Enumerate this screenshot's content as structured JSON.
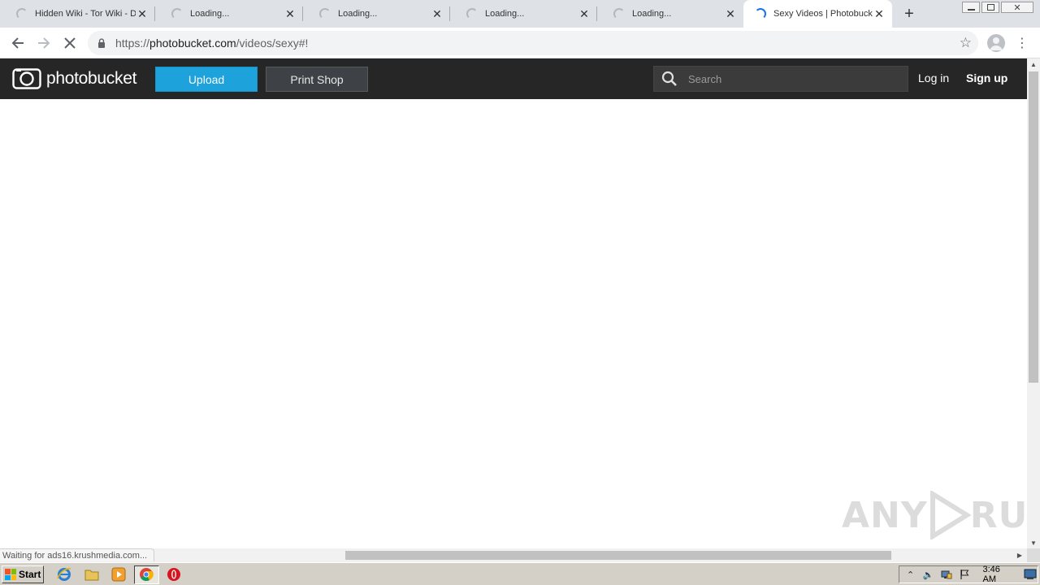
{
  "browser": {
    "tabs": [
      {
        "title": "Hidden Wiki - Tor Wiki - D",
        "active": false
      },
      {
        "title": "Loading...",
        "active": false
      },
      {
        "title": "Loading...",
        "active": false
      },
      {
        "title": "Loading...",
        "active": false
      },
      {
        "title": "Loading...",
        "active": false
      },
      {
        "title": "Sexy Videos | Photobuck",
        "active": true
      }
    ],
    "new_tab_symbol": "+",
    "url_scheme": "https://",
    "url_host": "photobucket.com",
    "url_path": "/videos/sexy#!",
    "status_text": "Waiting for ads16.krushmedia.com...",
    "icons": {
      "back": "back-arrow-icon",
      "forward": "forward-arrow-icon",
      "stop": "stop-loading-icon",
      "bookmark": "star-icon",
      "profile": "profile-avatar-icon",
      "menu": "kebab-menu-icon"
    }
  },
  "site": {
    "logo_text": "photobucket",
    "upload_label": "Upload",
    "print_shop_label": "Print Shop",
    "search_placeholder": "Search",
    "login_label": "Log in",
    "signup_label": "Sign up",
    "colors": {
      "header_bg": "#262626",
      "upload_bg": "#1ea2dc",
      "print_shop_bg": "#3e4246"
    }
  },
  "watermark": {
    "text_left": "ANY",
    "text_right": "RUN"
  },
  "taskbar": {
    "start_label": "Start",
    "clock": "3:46 AM",
    "pinned": [
      "internet-explorer-icon",
      "folder-icon",
      "media-player-icon",
      "chrome-icon",
      "opera-icon"
    ]
  }
}
